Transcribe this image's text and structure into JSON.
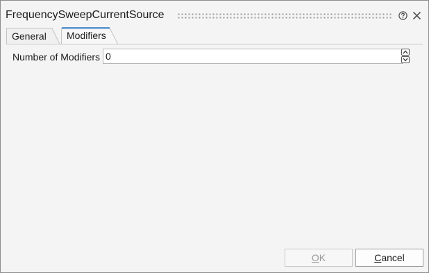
{
  "window": {
    "title": "FrequencySweepCurrentSource"
  },
  "icons": {
    "help": "help-icon",
    "close": "close-icon"
  },
  "tabs": [
    {
      "label": "General",
      "active": false
    },
    {
      "label": "Modifiers",
      "active": true
    }
  ],
  "form": {
    "modifiers_label": "Number of Modifiers",
    "modifiers_value": "0"
  },
  "buttons": {
    "ok_mnemonic": "O",
    "ok_rest": "K",
    "cancel_mnemonic": "C",
    "cancel_rest": "ancel"
  },
  "colors": {
    "dialog_bg": "#f4f4f4",
    "active_tab_accent": "#2b78c5",
    "disabled_text": "#9a9a9a"
  }
}
